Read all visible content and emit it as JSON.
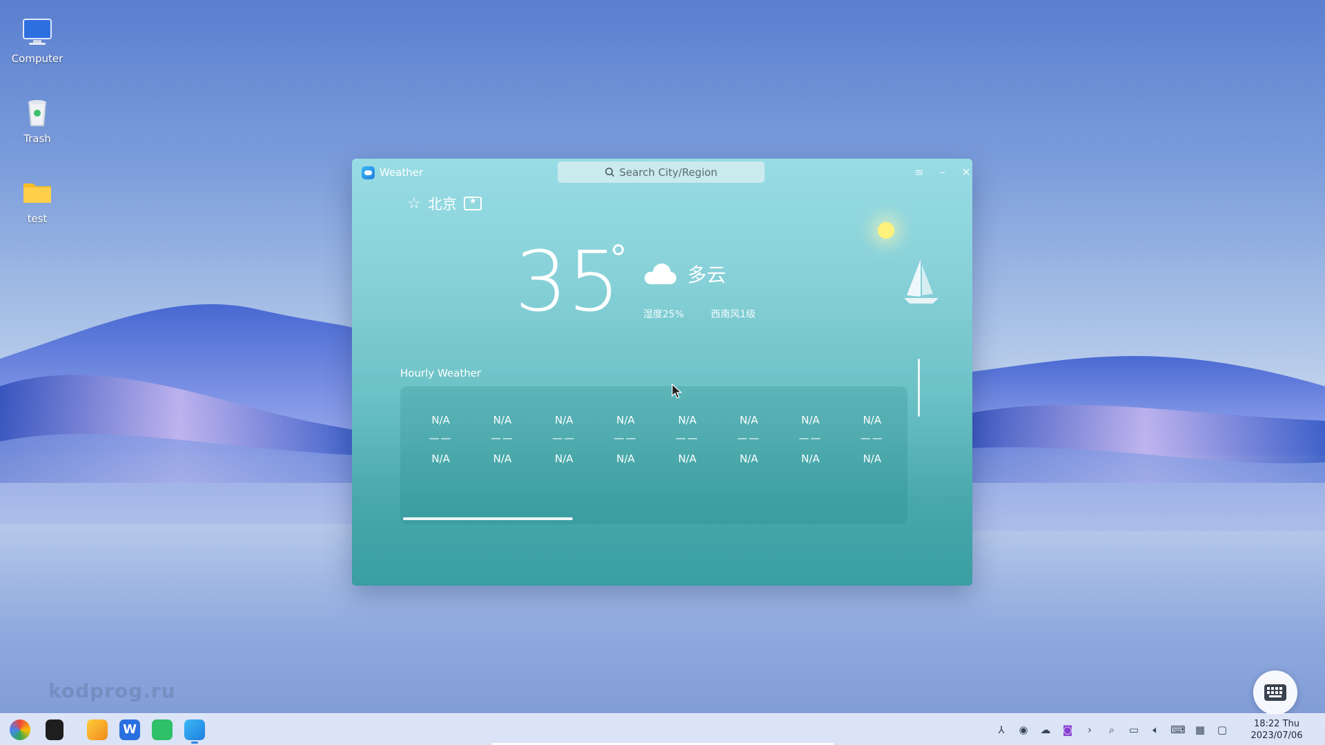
{
  "desktop": {
    "icons": [
      {
        "label": "Computer",
        "icon": "computer-icon"
      },
      {
        "label": "Trash",
        "icon": "trash-icon"
      },
      {
        "label": "test",
        "icon": "folder-icon"
      }
    ],
    "watermark": "kodprog.ru"
  },
  "weather_window": {
    "title": "Weather",
    "search_placeholder": "Search City/Region",
    "city": "北京",
    "temperature": "35",
    "condition": "多云",
    "humidity": "湿度25%",
    "wind": "西南风1级",
    "hourly_title": "Hourly Weather",
    "hourly": [
      {
        "top": "N/A",
        "mid": "——",
        "bottom": "N/A"
      },
      {
        "top": "N/A",
        "mid": "——",
        "bottom": "N/A"
      },
      {
        "top": "N/A",
        "mid": "——",
        "bottom": "N/A"
      },
      {
        "top": "N/A",
        "mid": "——",
        "bottom": "N/A"
      },
      {
        "top": "N/A",
        "mid": "——",
        "bottom": "N/A"
      },
      {
        "top": "N/A",
        "mid": "——",
        "bottom": "N/A"
      },
      {
        "top": "N/A",
        "mid": "——",
        "bottom": "N/A"
      },
      {
        "top": "N/A",
        "mid": "——",
        "bottom": "N/A"
      }
    ]
  },
  "taskbar": {
    "apps": [
      "launcher-icon",
      "multitask-view-icon",
      "app-store-icon",
      "wps-icon",
      "mail-icon",
      "weather-app-icon"
    ],
    "tray": [
      "network-icon",
      "input-method-icon",
      "cloud-icon",
      "screen-recorder-icon",
      "expand-tray-icon",
      "search-icon",
      "display-icon",
      "volume-icon",
      "keyboard-icon",
      "ime-icon",
      "notification-icon"
    ],
    "time": "18:22 Thu",
    "date": "2023/07/06"
  },
  "colors": {
    "accent": "#2a82e4",
    "window_top": "#98dce4",
    "window_bottom": "#3a9ea2"
  }
}
